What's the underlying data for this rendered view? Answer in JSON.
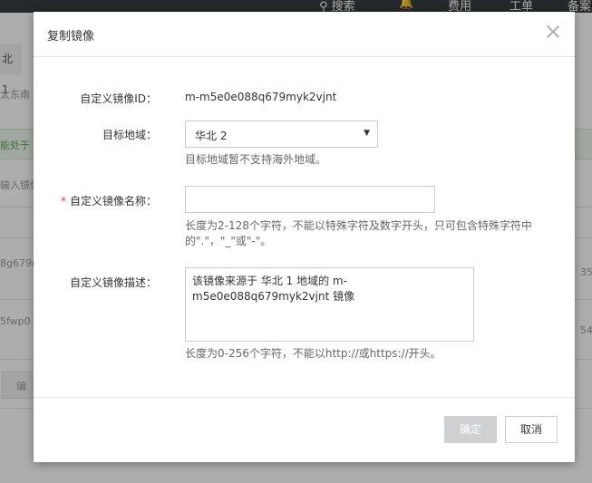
{
  "background": {
    "nav": {
      "search": "搜索",
      "billing": "费用",
      "ticket": "工单",
      "filing": "备案"
    },
    "region_tab": "北 1",
    "region_text": "太东南",
    "alert_text": "能处于",
    "search_placeholder": "输入镜像",
    "row1_id": "8g679n",
    "row1_time": "35",
    "row2_id": "5fwp0",
    "row2_time": "54",
    "edit_btn": "编"
  },
  "dialog": {
    "title": "复制镜像",
    "image_id_label": "自定义镜像ID：",
    "image_id_value": "m-m5e0e088q679myk2vjnt",
    "region_label": "目标地域：",
    "region_value": "华北 2",
    "region_help": "目标地域暂不支持海外地域。",
    "required_mark": "*",
    "name_label": "自定义镜像名称：",
    "name_value": "",
    "name_help": "长度为2-128个字符，不能以特殊字符及数字开头，只可包含特殊字符中的\".\"，\"_\"或\"-\"。",
    "desc_label": "自定义镜像描述：",
    "desc_value": "该镜像来源于 华北 1 地域的 m-m5e0e088q679myk2vjnt 镜像",
    "desc_help": "长度为0-256个字符，不能以http://或https://开头。",
    "ok_label": "确定",
    "cancel_label": "取消"
  },
  "colors": {
    "ok_disabled": "#cfd0d1",
    "required": "#e4393c",
    "topbar": "#373d41"
  }
}
